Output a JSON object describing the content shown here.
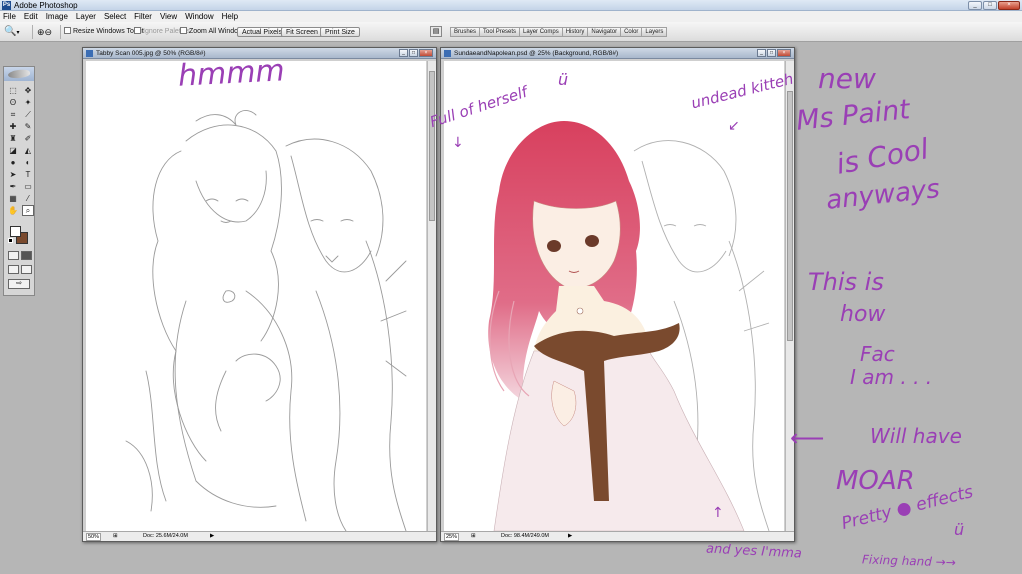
{
  "app": {
    "title": "Adobe Photoshop",
    "icon_name": "photoshop-app-icon",
    "window_buttons": [
      "_",
      "□",
      "×"
    ]
  },
  "menu": [
    "File",
    "Edit",
    "Image",
    "Layer",
    "Select",
    "Filter",
    "View",
    "Window",
    "Help"
  ],
  "options": {
    "tool_icon": "zoom-icon",
    "resize_windows": "Resize Windows To Fit",
    "ignore_palettes": "Ignore Palettes",
    "zoom_all": "Zoom All Windows",
    "actual_pixels": "Actual Pixels",
    "fit_screen": "Fit Screen",
    "print_size": "Print Size"
  },
  "palette_well": {
    "icon_name": "file-browser-icon",
    "tabs": [
      "Brushes",
      "Tool Presets",
      "Layer Comps",
      "History",
      "Navigator",
      "Color",
      "Layers"
    ]
  },
  "toolbox": {
    "icon_names": [
      "marquee-icon",
      "move-icon",
      "lasso-icon",
      "magic-wand-icon",
      "crop-icon",
      "slice-icon",
      "healing-brush-icon",
      "brush-icon",
      "clone-stamp-icon",
      "history-brush-icon",
      "eraser-icon",
      "paint-bucket-icon",
      "blur-icon",
      "dodge-icon",
      "path-selection-icon",
      "type-icon",
      "pen-icon",
      "shape-icon",
      "notes-icon",
      "eyedropper-icon",
      "hand-icon",
      "zoom-icon"
    ],
    "foreground_color": "#ffffff",
    "background_color": "#7a4a2e"
  },
  "doc_left": {
    "title": "Tabby Scan 005.jpg @ 50% (RGB/8#)",
    "zoom": "50%",
    "doc_size": "Doc: 25.6M/24.0M",
    "arrow": "▶"
  },
  "doc_right": {
    "title": "SundaeandNapolean.psd @ 25% (Background, RGB/8#)",
    "zoom": "25%",
    "doc_size": "Doc: 98.4M/249.0M",
    "arrow": "▶"
  },
  "annotations": {
    "hmm": "hmmm",
    "full_of_herself": "Full of herself",
    "smiley": "ü",
    "undead_kitteh": "undead kitteh",
    "new": "new",
    "ms_paint": "Ms Paint",
    "is_cool": "is Cool",
    "anyways": "anyways",
    "this_is": "This is",
    "how": "how",
    "fac": "Fac",
    "i_am": "I am . . .",
    "will_have": "Will have",
    "moar": "MOAR",
    "pretty_effects": "Pretty ● effects",
    "smiley2": "ü",
    "and_yes": "and yes I'mma",
    "fixing_hand": "Fixing hand →→"
  },
  "colors": {
    "annotation": "#9a3fb5",
    "workspace": "#b6b6b6",
    "hair": "#d84a6c",
    "scarf": "#7a4a2e"
  }
}
